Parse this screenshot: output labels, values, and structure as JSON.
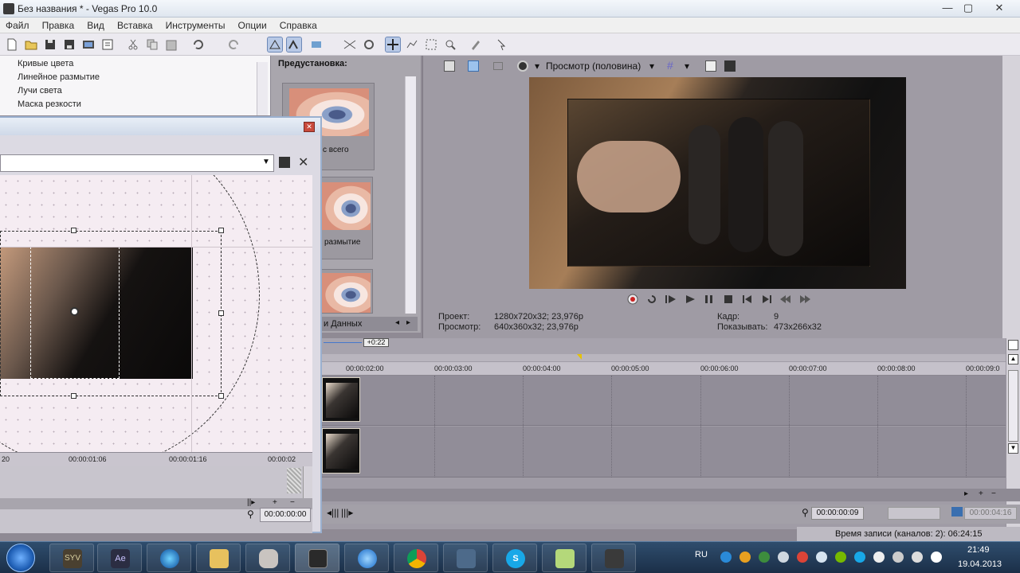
{
  "window": {
    "title": "Без названия * - Vegas Pro 10.0",
    "min": "—",
    "max": "▢",
    "close": "✕"
  },
  "menu": [
    "Файл",
    "Правка",
    "Вид",
    "Вставка",
    "Инструменты",
    "Опции",
    "Справка"
  ],
  "fx_list": [
    "Кривые цвета",
    "Линейное размытие",
    "Лучи света",
    "Маска резкости"
  ],
  "presets": {
    "header": "Предустановка:",
    "items": [
      "с всего",
      "размытие",
      ""
    ],
    "tab_label": "и Данных"
  },
  "preview": {
    "mode_label": "Просмотр (половина)",
    "project_label": "Проект:",
    "project_value": "1280x720x32; 23,976p",
    "preview_label": "Просмотр:",
    "preview_value": "640x360x32; 23,976p",
    "frame_label": "Кадр:",
    "frame_value": "9",
    "display_label": "Показывать:",
    "display_value": "473x266x32"
  },
  "timeline": {
    "offset_badge": "+0:22",
    "ruler": [
      "00:00:02:00",
      "00:00:03:00",
      "00:00:04:00",
      "00:00:05:00",
      "00:00:06:00",
      "00:00:07:00",
      "00:00:08:00",
      "00:00:09:0"
    ],
    "cursor_time": "00:00:00:09",
    "end_time": "00:00:04:16",
    "record_status": "Время записи (каналов: 2): 06:24:15"
  },
  "dialog": {
    "ruler": [
      "20",
      "00:00:01:06",
      "00:00:01:16",
      "00:00:02"
    ],
    "time": "00:00:00:00"
  },
  "taskbar": {
    "apps": [
      "start-orb",
      "sony-vegas",
      "after-effects",
      "media-player",
      "explorer",
      "app-figure",
      "vegas-active",
      "ie",
      "chrome",
      "system-tool",
      "skype",
      "notes",
      "camera-app"
    ],
    "lang": "RU",
    "time": "21:49",
    "date": "19.04.2013"
  },
  "colors": {
    "accent": "#b8c9e6",
    "panel": "#a9a6ad",
    "canvas": "#f5ecf2"
  }
}
